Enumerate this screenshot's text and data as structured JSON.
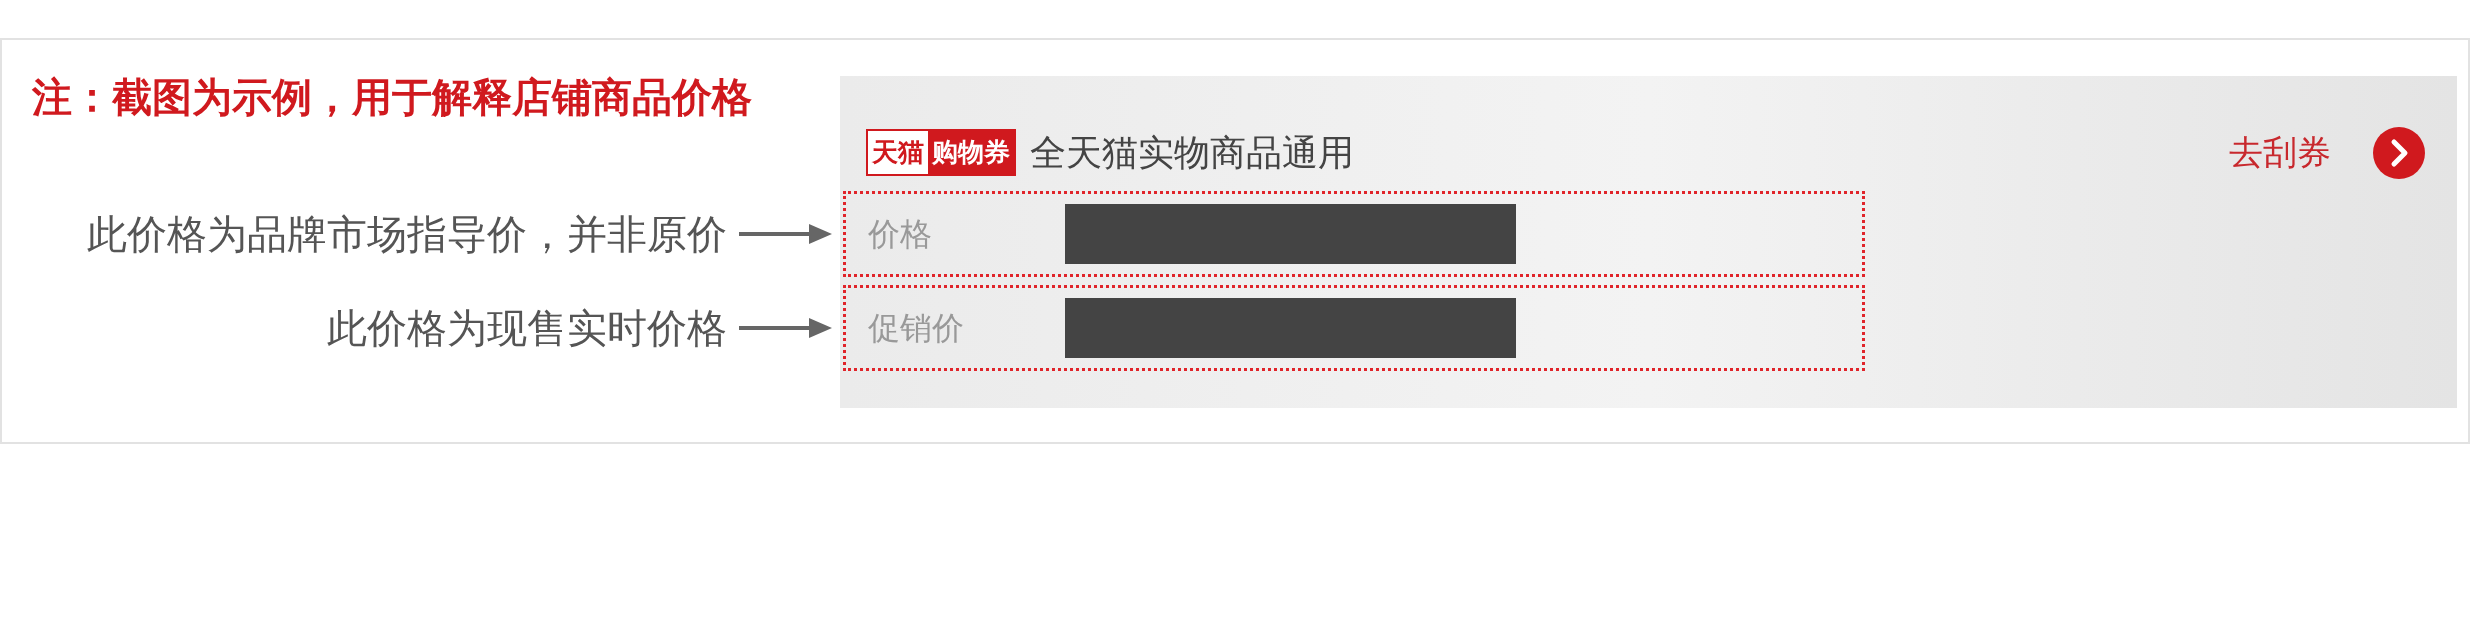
{
  "note": "注：截图为示例，用于解释店铺商品价格",
  "coupon": {
    "brand": "天猫",
    "badge": "购物券",
    "description": "全天猫实物商品通用",
    "action": "去刮券"
  },
  "annotations": [
    {
      "text": "此价格为品牌市场指导价，并非原价",
      "label": "价格"
    },
    {
      "text": "此价格为现售实时价格",
      "label": "促销价"
    }
  ]
}
